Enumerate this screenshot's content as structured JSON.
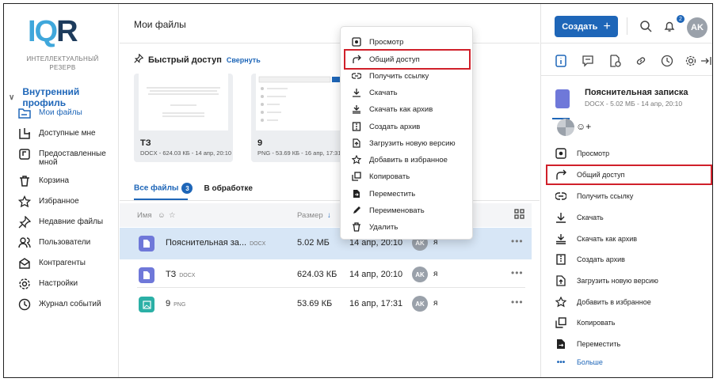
{
  "logo": {
    "letters_a": "IQ",
    "letters_b": "R",
    "tagline": "ИНТЕЛЛЕКТУАЛЬНЫЙ РЕЗЕРВ"
  },
  "sidebar": {
    "profile": "Внутренний профиль",
    "items": [
      {
        "label": "Мои файлы",
        "icon": "folder-icon"
      },
      {
        "label": "Доступные мне",
        "icon": "shared-with-me-icon"
      },
      {
        "label": "Предоставленные мной",
        "icon": "shared-by-me-icon"
      },
      {
        "label": "Корзина",
        "icon": "trash-icon"
      },
      {
        "label": "Избранное",
        "icon": "star-icon"
      },
      {
        "label": "Недавние файлы",
        "icon": "pin-icon"
      },
      {
        "label": "Пользователи",
        "icon": "users-icon"
      },
      {
        "label": "Контрагенты",
        "icon": "contractors-icon"
      },
      {
        "label": "Настройки",
        "icon": "gear-icon"
      },
      {
        "label": "Журнал событий",
        "icon": "clock-icon"
      }
    ]
  },
  "main": {
    "title": "Мои файлы",
    "quick_access": {
      "label": "Быстрый доступ",
      "collapse": "Свернуть"
    },
    "cards": [
      {
        "name": "ТЗ",
        "meta": "DOCX - 624.03 КБ - 14 апр, 20:10"
      },
      {
        "name": "9",
        "meta": "PNG - 53.69 КБ - 16 апр, 17:31"
      }
    ],
    "tabs": {
      "all": "Все файлы",
      "count": "3",
      "processing": "В обработке"
    },
    "columns": {
      "name": "Имя",
      "size": "Размер"
    },
    "rows": [
      {
        "name": "Пояснительная за...",
        "type": "DOCX",
        "size": "5.02 МБ",
        "date": "14 апр, 20:10",
        "owner_initials": "AK",
        "owner": "я",
        "more": "•••"
      },
      {
        "name": "ТЗ",
        "type": "DOCX",
        "size": "624.03 КБ",
        "date": "14 апр, 20:10",
        "owner_initials": "AK",
        "owner": "я",
        "more": "•••"
      },
      {
        "name": "9",
        "type": "PNG",
        "size": "53.69 КБ",
        "date": "16 апр, 17:31",
        "owner_initials": "AK",
        "owner": "я",
        "more": "•••"
      }
    ]
  },
  "context_menu": [
    {
      "label": "Просмотр",
      "icon": "view-icon"
    },
    {
      "label": "Общий доступ",
      "icon": "share-arrow-icon",
      "highlighted": true
    },
    {
      "label": "Получить ссылку",
      "icon": "link-icon"
    },
    {
      "label": "Скачать",
      "icon": "download-icon"
    },
    {
      "label": "Скачать как архив",
      "icon": "download-archive-icon"
    },
    {
      "label": "Создать архив",
      "icon": "archive-icon"
    },
    {
      "label": "Загрузить новую версию",
      "icon": "upload-version-icon"
    },
    {
      "label": "Добавить в избранное",
      "icon": "star-icon"
    },
    {
      "label": "Копировать",
      "icon": "copy-icon"
    },
    {
      "label": "Переместить",
      "icon": "move-icon"
    },
    {
      "label": "Переименовать",
      "icon": "rename-icon"
    },
    {
      "label": "Удалить",
      "icon": "trash-icon"
    }
  ],
  "topbar": {
    "create": "Создать",
    "notifications": "2",
    "user_initials": "AK"
  },
  "panel": {
    "file_name": "Пояснительная записка",
    "file_meta": "DOCX - 5.02 МБ - 14 апр, 20:10",
    "actions": [
      {
        "label": "Просмотр",
        "icon": "view-icon"
      },
      {
        "label": "Общий доступ",
        "icon": "share-arrow-icon",
        "highlighted": true
      },
      {
        "label": "Получить ссылку",
        "icon": "link-icon"
      },
      {
        "label": "Скачать",
        "icon": "download-icon"
      },
      {
        "label": "Скачать как архив",
        "icon": "download-archive-icon"
      },
      {
        "label": "Создать архив",
        "icon": "archive-icon"
      },
      {
        "label": "Загрузить новую версию",
        "icon": "upload-version-icon"
      },
      {
        "label": "Добавить в избранное",
        "icon": "star-icon"
      },
      {
        "label": "Копировать",
        "icon": "copy-icon"
      },
      {
        "label": "Переместить",
        "icon": "move-icon"
      },
      {
        "label": "Больше",
        "icon": "more-icon"
      }
    ]
  },
  "colors": {
    "accent": "#1e66b8",
    "highlight_box": "#d0202a",
    "selected_row": "#d7e6f6",
    "doc_icon": "#6f78d9",
    "img_icon": "#2bb0a6"
  }
}
